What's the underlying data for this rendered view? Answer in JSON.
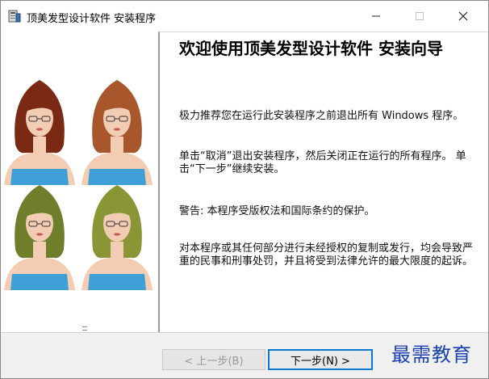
{
  "window": {
    "title": "顶美发型设计软件 安装程序",
    "controls": {
      "minimize_glyph": "—",
      "maximize_glyph": "☐",
      "close_glyph": "✕"
    }
  },
  "icons": {
    "app": "installer-icon",
    "minimize": "minimize-icon",
    "maximize": "maximize-icon",
    "close": "close-icon"
  },
  "welcome": {
    "title": "欢迎使用顶美发型设计软件 安装向导",
    "paragraph1": "极力推荐您在运行此安装程序之前退出所有 Windows 程序。",
    "paragraph2": "单击“取消”退出安装程序，然后关闭正在运行的所有程序。  单击“下一步”继续安装。",
    "paragraph3": "警告:  本程序受版权法和国际条约的保护。",
    "paragraph4": "对本程序或其任何部分进行未经授权的复制或发行，均会导致严重的民事和刑事处罚，并且将受到法律允许的最大限度的起诉。"
  },
  "buttons": {
    "back": "< 上一步(B)",
    "next": "下一步(N) >"
  },
  "watermark": "最需教育",
  "colors": {
    "hair_dark": "#7a2a14",
    "hair_auburn": "#a8562c",
    "hair_green": "#6e7e2a",
    "hair_olive": "#8a9636",
    "top_blue": "#3fa0d8",
    "skin": "#f2cdb4",
    "accent_blue": "#0a78d7",
    "watermark": "#1a3fb0"
  },
  "portraits": [
    {
      "name": "portrait-1"
    },
    {
      "name": "portrait-2"
    },
    {
      "name": "portrait-3"
    },
    {
      "name": "portrait-4"
    }
  ]
}
